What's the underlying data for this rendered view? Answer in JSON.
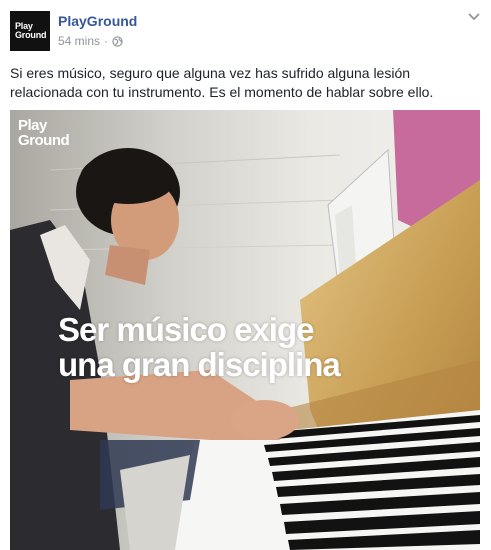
{
  "post": {
    "page_name": "PlayGround",
    "avatar_logo": [
      "Play",
      "Ground"
    ],
    "timestamp": "54 mins",
    "separator": "·",
    "text": "Si eres músico, seguro que alguna vez has sufrido alguna lesión relacionada con tu instrumento. Es el momento de hablar sobre ello."
  },
  "video": {
    "logo": [
      "Play",
      "Ground"
    ],
    "caption": [
      "Ser músico exige",
      "una gran disciplina"
    ]
  },
  "icons": {
    "privacy": "globe-icon",
    "menu": "chevron-down-icon"
  },
  "colors": {
    "link": "#365899",
    "meta": "#90949c",
    "text": "#1d2129",
    "piano_wood": "#c9a25a",
    "magenta_panel": "#c76a9c"
  }
}
